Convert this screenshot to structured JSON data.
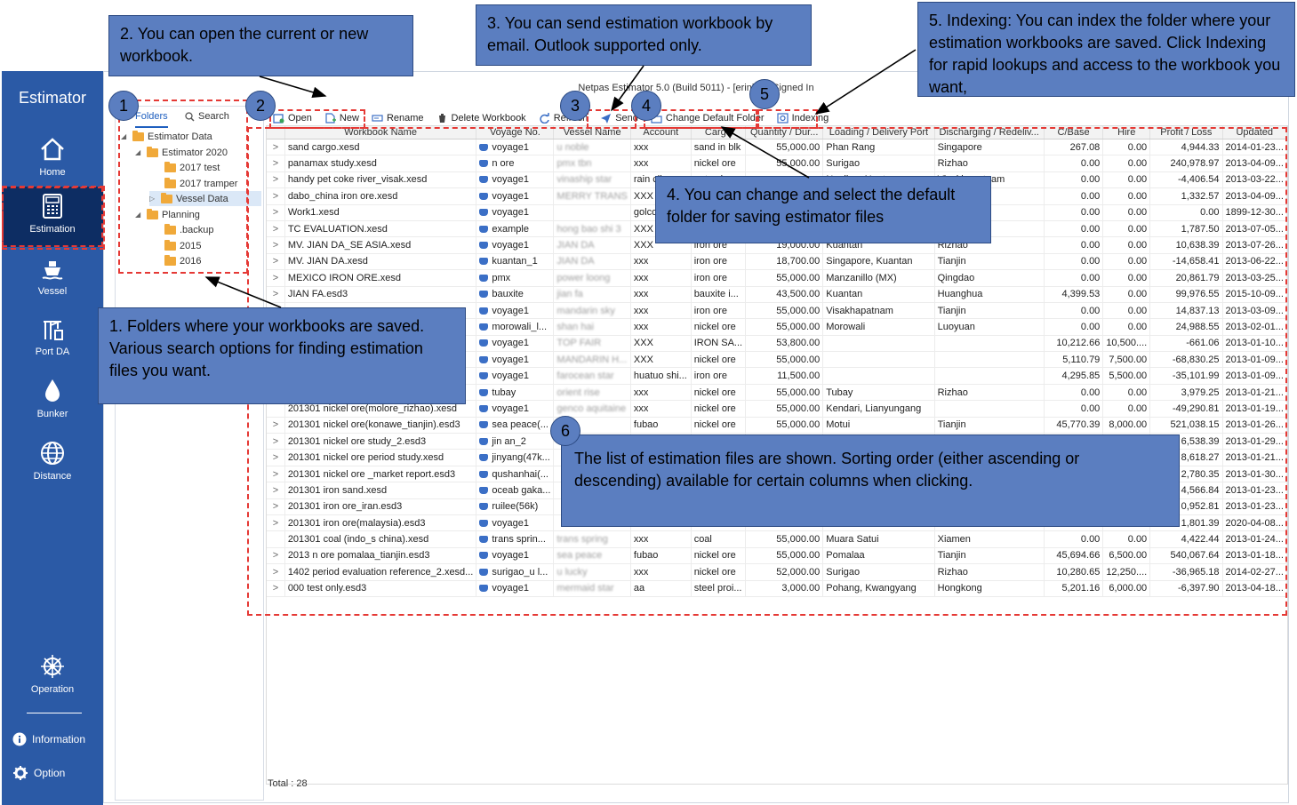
{
  "nav": {
    "brand": "Estimator",
    "items": [
      {
        "label": "Home",
        "icon": "home-icon"
      },
      {
        "label": "Estimation",
        "icon": "calculator-icon",
        "active": true
      },
      {
        "label": "Vessel",
        "icon": "ship-icon"
      },
      {
        "label": "Port DA",
        "icon": "port-crane-icon"
      },
      {
        "label": "Bunker",
        "icon": "fuel-drop-icon"
      },
      {
        "label": "Distance",
        "icon": "globe-icon"
      },
      {
        "label": "Operation",
        "icon": "ship-wheel-icon"
      }
    ],
    "information": "Information",
    "option": "Option"
  },
  "window": {
    "title": "Netpas Estimator 5.0 (Build 5011) - [erinkim] Signed In"
  },
  "panel": {
    "tab_folders": "Folders",
    "tab_search": "Search",
    "tree": [
      "Estimator Data",
      "Estimator 2020",
      "2017 test",
      "2017 tramper",
      "Vessel Data",
      "Planning",
      ".backup",
      "2015",
      "2016"
    ]
  },
  "toolbar": {
    "open": "Open",
    "new": "New",
    "rename": "Rename",
    "delete": "Delete Workbook",
    "refresh": "Refresh",
    "send": "Send",
    "change_folder": "Change Default Folder",
    "indexing": "Indexing"
  },
  "grid": {
    "columns": [
      "",
      "Workbook Name",
      "Voyage No.",
      "Vessel Name",
      "Account",
      "Cargo",
      "Quantity / Dur...",
      "Loading / Delivery Port",
      "Discharging / Redeliv...",
      "C/Base",
      "Hire",
      "Profit / Loss",
      "Updated"
    ],
    "rows": [
      [
        ">",
        "sand cargo.xesd",
        "voyage1",
        "u noble",
        "xxx",
        "sand in blk",
        "55,000.00",
        "Phan Rang",
        "Singapore",
        "267.08",
        "0.00",
        "4,944.33",
        "2014-01-23..."
      ],
      [
        ">",
        "panamax study.xesd",
        "n ore",
        "pmx tbn",
        "xxx",
        "nickel ore",
        "55,000.00",
        "Surigao",
        "Rizhao",
        "0.00",
        "0.00",
        "240,978.97",
        "2013-04-09..."
      ],
      [
        ">",
        "handy pet coke river_visak.xesd",
        "voyage1",
        "vinaship star",
        "rain cil car...",
        "pet coke",
        "",
        "Nanjing, Nantong",
        "Visakhapatnam",
        "0.00",
        "0.00",
        "-4,406.54",
        "2013-03-22..."
      ],
      [
        ">",
        "dabo_china iron ore.xesd",
        "voyage1",
        "MERRY TRANS",
        "XXX",
        "",
        "",
        "",
        "",
        "0.00",
        "0.00",
        "1,332.57",
        "2013-04-09..."
      ],
      [
        ">",
        "Work1.xesd",
        "voyage1",
        "",
        "golcon",
        "",
        "",
        "",
        "",
        "0.00",
        "0.00",
        "0.00",
        "1899-12-30..."
      ],
      [
        ">",
        "TC EVALUATION.xesd",
        "example",
        "hong bao shi 3",
        "XXX",
        "",
        "",
        "",
        "",
        "0.00",
        "0.00",
        "1,787.50",
        "2013-07-05..."
      ],
      [
        ">",
        "MV. JIAN DA_SE ASIA.xesd",
        "voyage1",
        "JIAN DA",
        "XXX",
        "iron ore",
        "19,000.00",
        "Kuantan",
        "Rizhao",
        "0.00",
        "0.00",
        "10,638.39",
        "2013-07-26..."
      ],
      [
        ">",
        "MV. JIAN DA.xesd",
        "kuantan_1",
        "JIAN DA",
        "xxx",
        "iron ore",
        "18,700.00",
        "Singapore, Kuantan",
        "Tianjin",
        "0.00",
        "0.00",
        "-14,658.41",
        "2013-06-22..."
      ],
      [
        ">",
        "MEXICO IRON ORE.xesd",
        "pmx",
        "power loong",
        "xxx",
        "iron ore",
        "55,000.00",
        "Manzanillo (MX)",
        "Qingdao",
        "0.00",
        "0.00",
        "20,861.79",
        "2013-03-25..."
      ],
      [
        ">",
        "JIAN FA.esd3",
        "bauxite",
        "jian fa",
        "xxx",
        "bauxite i...",
        "43,500.00",
        "Kuantan",
        "Huanghua",
        "4,399.53",
        "0.00",
        "99,976.55",
        "2015-10-09..."
      ],
      [
        ">",
        "",
        "voyage1",
        "mandarin sky",
        "xxx",
        "iron ore",
        "55,000.00",
        "Visakhapatnam",
        "Tianjin",
        "0.00",
        "0.00",
        "14,837.13",
        "2013-03-09..."
      ],
      [
        ">",
        "",
        "morowali_l...",
        "shan hai",
        "xxx",
        "nickel ore",
        "55,000.00",
        "Morowali",
        "Luoyuan",
        "0.00",
        "0.00",
        "24,988.55",
        "2013-02-01..."
      ],
      [
        ">",
        "",
        "voyage1",
        "TOP FAIR",
        "XXX",
        "IRON SA...",
        "53,800.00",
        "",
        "",
        "10,212.66",
        "10,500....",
        "-661.06",
        "2013-01-10..."
      ],
      [
        ">",
        "",
        "voyage1",
        "MANDARIN H...",
        "XXX",
        "nickel ore",
        "55,000.00",
        "",
        "",
        "5,110.79",
        "7,500.00",
        "-68,830.25",
        "2013-01-09..."
      ],
      [
        ">",
        "",
        "voyage1",
        "farocean star",
        "huatuo shi...",
        "iron ore",
        "11,500.00",
        "",
        "",
        "4,295.85",
        "5,500.00",
        "-35,101.99",
        "2013-01-09..."
      ],
      [
        ">",
        "",
        "tubay",
        "orient rise",
        "xxx",
        "nickel ore",
        "55,000.00",
        "Tubay",
        "Rizhao",
        "0.00",
        "0.00",
        "3,979.25",
        "2013-01-21..."
      ],
      [
        "",
        "201301 nickel ore(molore_rizhao).xesd",
        "voyage1",
        "genco aquitaine",
        "xxx",
        "nickel ore",
        "55,000.00",
        "Kendari, Lianyungang",
        "",
        "0.00",
        "0.00",
        "-49,290.81",
        "2013-01-19..."
      ],
      [
        ">",
        "201301 nickel ore(konawe_tianjin).esd3",
        "sea peace(...",
        "",
        "fubao",
        "nickel ore",
        "55,000.00",
        "Motui",
        "Tianjin",
        "45,770.39",
        "8,000.00",
        "521,038.15",
        "2013-01-26..."
      ],
      [
        ">",
        "201301 nickel ore study_2.esd3",
        "jin an_2",
        "",
        "",
        "",
        "",
        "",
        "",
        "",
        "",
        "6,538.39",
        "2013-01-29..."
      ],
      [
        ">",
        "201301 nickel ore period study.xesd",
        "jinyang(47k...",
        "",
        "",
        "",
        "",
        "",
        "",
        "",
        "",
        "8,618.27",
        "2013-01-21..."
      ],
      [
        ">",
        "201301 nickel ore _market report.esd3",
        "qushanhai(...",
        "",
        "",
        "",
        "",
        "",
        "",
        "",
        "",
        "2,780.35",
        "2013-01-30..."
      ],
      [
        ">",
        "201301 iron sand.xesd",
        "oceab gaka...",
        "",
        "",
        "",
        "",
        "",
        "",
        "",
        "",
        "4,566.84",
        "2013-01-23..."
      ],
      [
        ">",
        "201301 iron ore_iran.esd3",
        "ruilee(56k)",
        "",
        "",
        "",
        "",
        "",
        "",
        "",
        "",
        "0,952.81",
        "2013-01-23..."
      ],
      [
        ">",
        "201301 iron ore(malaysia).esd3",
        "voyage1",
        "",
        "",
        "",
        "",
        "",
        "",
        "",
        "",
        "1,801.39",
        "2020-04-08..."
      ],
      [
        "",
        "201301 coal (indo_s china).xesd",
        "trans sprin...",
        "trans spring",
        "xxx",
        "coal",
        "55,000.00",
        "Muara Satui",
        "Xiamen",
        "0.00",
        "0.00",
        "4,422.44",
        "2013-01-24..."
      ],
      [
        ">",
        "2013 n ore pomalaa_tianjin.esd3",
        "voyage1",
        "sea peace",
        "fubao",
        "nickel ore",
        "55,000.00",
        "Pomalaa",
        "Tianjin",
        "45,694.66",
        "6,500.00",
        "540,067.64",
        "2013-01-18..."
      ],
      [
        ">",
        "1402 period evaluation reference_2.xesd...",
        "surigao_u l...",
        "u lucky",
        "xxx",
        "nickel ore",
        "52,000.00",
        "Surigao",
        "Rizhao",
        "10,280.65",
        "12,250....",
        "-36,965.18",
        "2014-02-27..."
      ],
      [
        ">",
        "000 test only.esd3",
        "voyage1",
        "mermaid star",
        "aa",
        "steel proi...",
        "3,000.00",
        "Pohang, Kwangyang",
        "Hongkong",
        "5,201.16",
        "6,000.00",
        "-6,397.90",
        "2013-04-18..."
      ]
    ],
    "total": "Total : 28"
  },
  "annotations": {
    "c1": "1. Folders where your workbooks are saved. Various search options for finding estimation files you want.",
    "c2": "2. You can open the current or new workbook.",
    "c3": "3.  You can send estimation workbook by email. Outlook supported only.",
    "c4": "4.  You can change and  select  the default folder for saving estimator files",
    "c5": "5. Indexing: You can index the folder where your estimation workbooks are saved. Click Indexing for rapid lookups and access to the workbook you want,",
    "c6": "The list of estimation files are shown. Sorting order (either ascending or descending) available for certain columns when clicking.",
    "n1": "1",
    "n2": "2",
    "n3": "3",
    "n4": "4",
    "n5": "5",
    "n6": "6"
  },
  "colors": {
    "nav": "#2b5aa6",
    "callout": "#5b7ec0",
    "dash": "#e53935"
  }
}
